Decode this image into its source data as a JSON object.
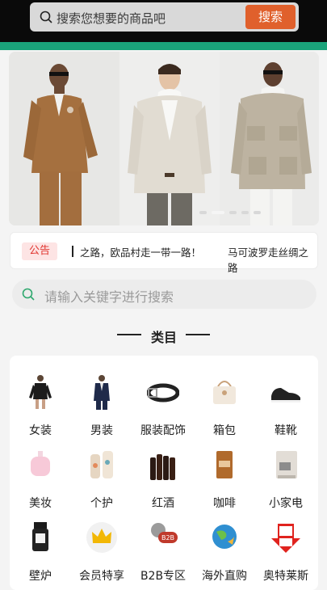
{
  "header": {
    "search_placeholder": "搜索您想要的商品吧",
    "search_button": "搜索"
  },
  "banner": {
    "models": [
      "model-brown-suit",
      "model-cream-blazer",
      "model-beige-jacket"
    ],
    "indicator_count": 5,
    "active_indicator": 1
  },
  "notice": {
    "tag": "公告",
    "text_primary": "之路，欧品村走一带一路！",
    "text_secondary": "马可波罗走丝绸之路"
  },
  "search": {
    "placeholder": "请输入关键字进行搜索"
  },
  "section": {
    "title": "类目"
  },
  "categories": [
    {
      "label": "女装",
      "icon": "womens-clothing-icon"
    },
    {
      "label": "男装",
      "icon": "mens-clothing-icon"
    },
    {
      "label": "服装配饰",
      "icon": "belt-icon"
    },
    {
      "label": "箱包",
      "icon": "handbag-icon"
    },
    {
      "label": "鞋靴",
      "icon": "sneaker-icon"
    },
    {
      "label": "美妆",
      "icon": "perfume-icon"
    },
    {
      "label": "个护",
      "icon": "skincare-bottles-icon"
    },
    {
      "label": "红酒",
      "icon": "wine-bottles-icon"
    },
    {
      "label": "咖啡",
      "icon": "coffee-bag-icon"
    },
    {
      "label": "小家电",
      "icon": "coffee-machine-icon"
    },
    {
      "label": "壁炉",
      "icon": "fireplace-icon"
    },
    {
      "label": "会员特享",
      "icon": "crown-icon"
    },
    {
      "label": "B2B专区",
      "icon": "b2b-icon"
    },
    {
      "label": "海外直购",
      "icon": "globe-icon"
    },
    {
      "label": "奥特莱斯",
      "icon": "outlet-icon"
    }
  ],
  "colors": {
    "accent_green": "#1aa37a",
    "search_button": "#e0602c",
    "notice_red": "#e0342e"
  }
}
